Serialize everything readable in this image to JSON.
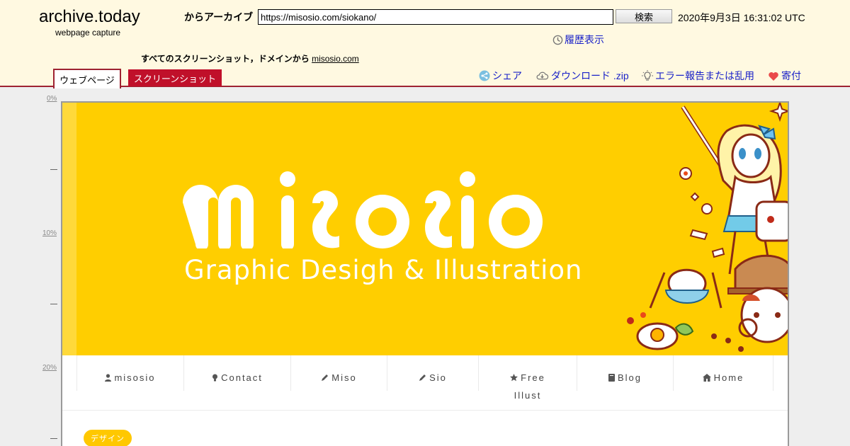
{
  "header": {
    "brand": "archive.today",
    "brand_sub": "webpage capture",
    "archive_label": "からアーカイブ",
    "url_value": "https://misosio.com/siokano/",
    "search_label": "検索",
    "timestamp": "2020年9月3日 16:31:02 UTC",
    "history_label": "履歴表示",
    "all_screenshots_text": "すべてのスクリーンショット，ドメインから",
    "all_screenshots_domain": "misosio.com"
  },
  "tabs": [
    {
      "label": "ウェブページ",
      "active": true
    },
    {
      "label": "スクリーンショット",
      "active": false
    }
  ],
  "actions": {
    "share": "シェア",
    "download": "ダウンロード .zip",
    "report": "エラー報告または乱用",
    "donate": "寄付"
  },
  "ruler": [
    "0%",
    "10%",
    "20%"
  ],
  "site": {
    "logo_text": "misosio",
    "tagline": "Graphic Desigh & Illustration",
    "nav": [
      {
        "label": "misosio",
        "icon": "user-icon"
      },
      {
        "label": "Contact",
        "icon": "lightbulb-icon"
      },
      {
        "label": "Miso",
        "icon": "pencil-icon"
      },
      {
        "label": "Sio",
        "icon": "pencil-icon"
      },
      {
        "label": "Free",
        "label2": "Illust",
        "icon": "star-icon"
      },
      {
        "label": "Blog",
        "icon": "book-icon"
      },
      {
        "label": "Home",
        "icon": "home-icon"
      }
    ],
    "category_badge": "デザイン"
  },
  "colors": {
    "accent_red": "#9e2332",
    "tab_red": "#c0102a",
    "link_blue": "#1a22c8",
    "banner_yellow": "#ffce00",
    "header_bg": "#fff9e1"
  }
}
